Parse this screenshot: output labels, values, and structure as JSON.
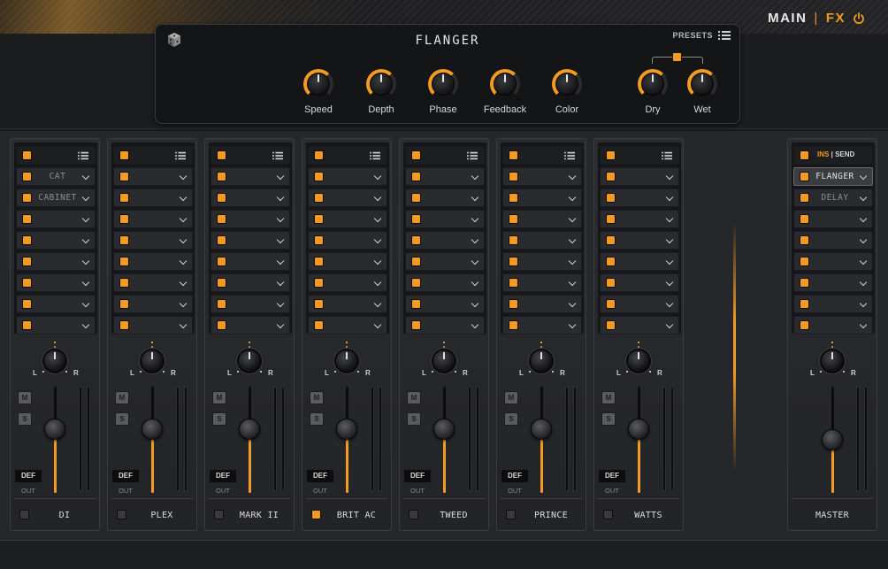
{
  "nav": {
    "main_label": "MAIN",
    "separator": "|",
    "fx_label": "FX",
    "power_icon": "power-icon"
  },
  "fx_panel": {
    "title": "FLANGER",
    "presets_label": "PRESETS",
    "knobs": [
      {
        "label": "Speed"
      },
      {
        "label": "Depth"
      },
      {
        "label": "Phase"
      },
      {
        "label": "Feedback"
      },
      {
        "label": "Color"
      },
      {
        "label": "Dry"
      },
      {
        "label": "Wet"
      }
    ]
  },
  "channels": [
    {
      "name": "DI",
      "enabled": false,
      "slots": [
        "CAT",
        "CABINET",
        "",
        "",
        "",
        "",
        "",
        ""
      ]
    },
    {
      "name": "PLEX",
      "enabled": false,
      "slots": [
        "",
        "",
        "",
        "",
        "",
        "",
        "",
        ""
      ]
    },
    {
      "name": "MARK II",
      "enabled": false,
      "slots": [
        "",
        "",
        "",
        "",
        "",
        "",
        "",
        ""
      ]
    },
    {
      "name": "BRIT AC",
      "enabled": true,
      "slots": [
        "",
        "",
        "",
        "",
        "",
        "",
        "",
        ""
      ]
    },
    {
      "name": "TWEED",
      "enabled": false,
      "slots": [
        "",
        "",
        "",
        "",
        "",
        "",
        "",
        ""
      ]
    },
    {
      "name": "PRINCE",
      "enabled": false,
      "slots": [
        "",
        "",
        "",
        "",
        "",
        "",
        "",
        ""
      ]
    },
    {
      "name": "WATTS",
      "enabled": false,
      "slots": [
        "",
        "",
        "",
        "",
        "",
        "",
        "",
        ""
      ]
    }
  ],
  "master": {
    "name": "MASTER",
    "ins_label": "INS",
    "send_label": "SEND",
    "separator": "|",
    "slots": [
      "FLANGER",
      "DELAY",
      "",
      "",
      "",
      "",
      "",
      ""
    ],
    "active_slot": 0
  },
  "strip_labels": {
    "mute": "M",
    "solo": "S",
    "def": "DEF",
    "out": "OUT",
    "pan_l": "L",
    "pan_r": "R"
  },
  "colors": {
    "accent": "#f29a23",
    "panel": "#141516",
    "strip": "#2b2c2f"
  }
}
